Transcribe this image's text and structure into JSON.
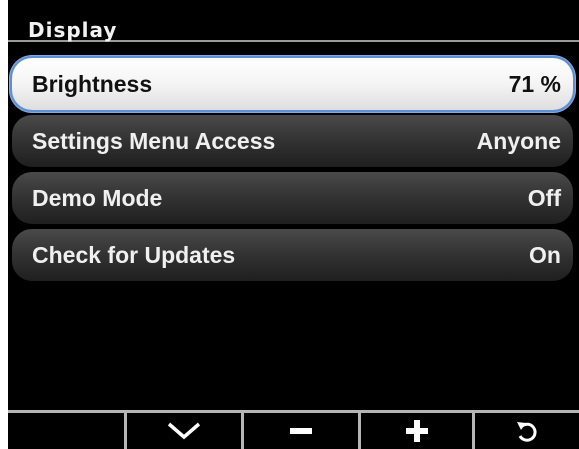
{
  "header": {
    "title": "Display"
  },
  "menu": {
    "items": [
      {
        "label": "Brightness",
        "value": "71 %",
        "selected": true
      },
      {
        "label": "Settings Menu Access",
        "value": "Anyone",
        "selected": false
      },
      {
        "label": "Demo Mode",
        "value": "Off",
        "selected": false
      },
      {
        "label": "Check for Updates",
        "value": "On",
        "selected": false
      }
    ]
  },
  "softkeys": [
    {
      "icon": "blank"
    },
    {
      "icon": "chevron-down-icon"
    },
    {
      "icon": "minus-icon"
    },
    {
      "icon": "plus-icon"
    },
    {
      "icon": "back-arrow-icon"
    }
  ],
  "colors": {
    "selection_outline": "#5b8fd6",
    "background": "#000000",
    "text": "#f0f0f0"
  }
}
